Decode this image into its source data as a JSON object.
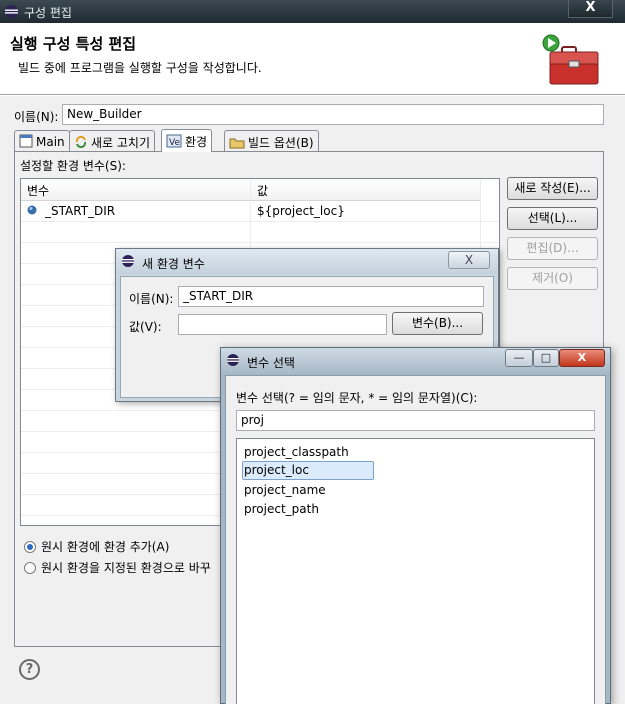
{
  "window": {
    "title": "구성 편집",
    "close": "X"
  },
  "banner": {
    "title": "실행 구성 특성 편집",
    "description": "빌드 중에 프로그램을 실행할 구성을 작성합니다."
  },
  "name_field": {
    "label": "이름(N):",
    "value": "New_Builder"
  },
  "tabs": [
    {
      "label": "Main",
      "icon": "main-icon"
    },
    {
      "label": "새로 고치기",
      "icon": "refresh-icon"
    },
    {
      "label": "환경",
      "icon": "environment-icon",
      "active": true
    },
    {
      "label": "빌드 옵션(B)",
      "icon": "build-options-icon"
    }
  ],
  "environment": {
    "label": "설정할 환경 변수(S):",
    "columns": [
      "변수",
      "값"
    ],
    "rows": [
      {
        "variable": "_START_DIR",
        "value": "${project_loc}"
      }
    ],
    "buttons": {
      "new": "새로 작성(E)...",
      "select": "선택(L)...",
      "edit": "편집(D)...",
      "remove": "제거(O)"
    },
    "radio_append": "원시 환경에 환경 추가(A)",
    "radio_replace": "원시 환경을 지정된 환경으로 바꾸"
  },
  "help": "?",
  "new_env_dialog": {
    "title": "새 환경 변수",
    "close": "X",
    "name_label": "이름(N):",
    "name_value": "_START_DIR",
    "value_label": "값(V):",
    "value_value": "",
    "variables_button": "변수(B)..."
  },
  "select_var_dialog": {
    "title": "변수 선택",
    "prompt": "변수 선택(? = 임의 문자, * = 임의 문자열)(C):",
    "filter": "proj",
    "items": [
      "project_classpath",
      "project_loc",
      "project_name",
      "project_path"
    ],
    "selected": "project_loc",
    "min": "—",
    "max": "□",
    "close": "X"
  },
  "colors": {
    "titlebar": "#1f2a31",
    "selection": "#dcebfc",
    "dialog_frame": "#a8b7c5"
  }
}
